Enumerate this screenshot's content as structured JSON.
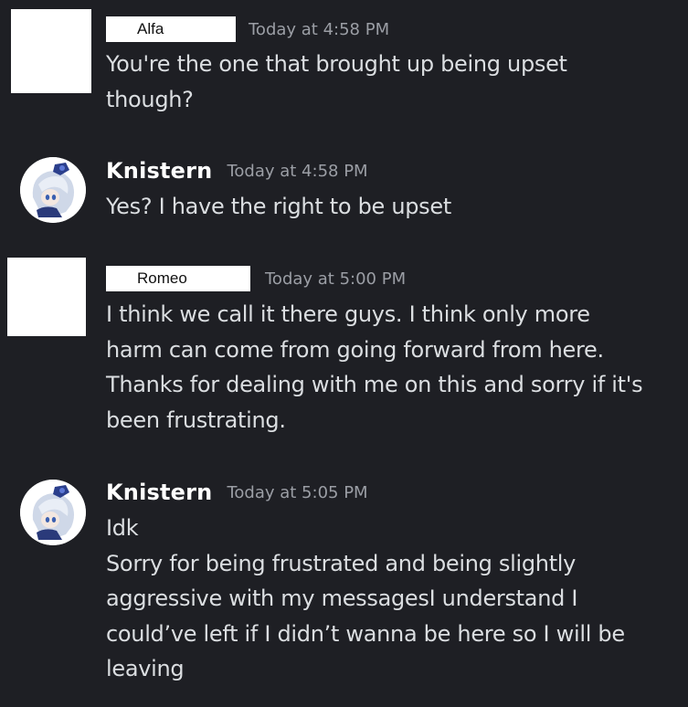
{
  "messages": [
    {
      "author": "Alfa",
      "timestamp": "Today at 4:58 PM",
      "lines": [
        "You're the one that brought up being upset",
        "though?"
      ]
    },
    {
      "author": "Knistern",
      "timestamp": "Today at 4:58 PM",
      "lines": [
        "Yes? I have the right to be upset"
      ]
    },
    {
      "author": "Romeo",
      "timestamp": "Today at 5:00 PM",
      "lines": [
        "I think we call it there guys. I think only more",
        "harm can come from going forward from here.",
        "Thanks for dealing with me on this and sorry if it's",
        "been frustrating."
      ]
    },
    {
      "author": "Knistern",
      "timestamp": "Today at 5:05 PM",
      "lines": [
        "Idk",
        "Sorry for being frustrated and being slightly",
        "aggressive with my messagesI understand I",
        "could’ve left if I didn’t wanna be here so I will be",
        "leaving"
      ]
    }
  ],
  "colors": {
    "background": "#1e1f24",
    "username": "#ffffff",
    "timestamp": "#9b9ea5",
    "message_text": "#dbdee1",
    "redaction": "#ffffff"
  },
  "icons": {
    "avatar_knistern": "anime-character-avatar-icon"
  }
}
